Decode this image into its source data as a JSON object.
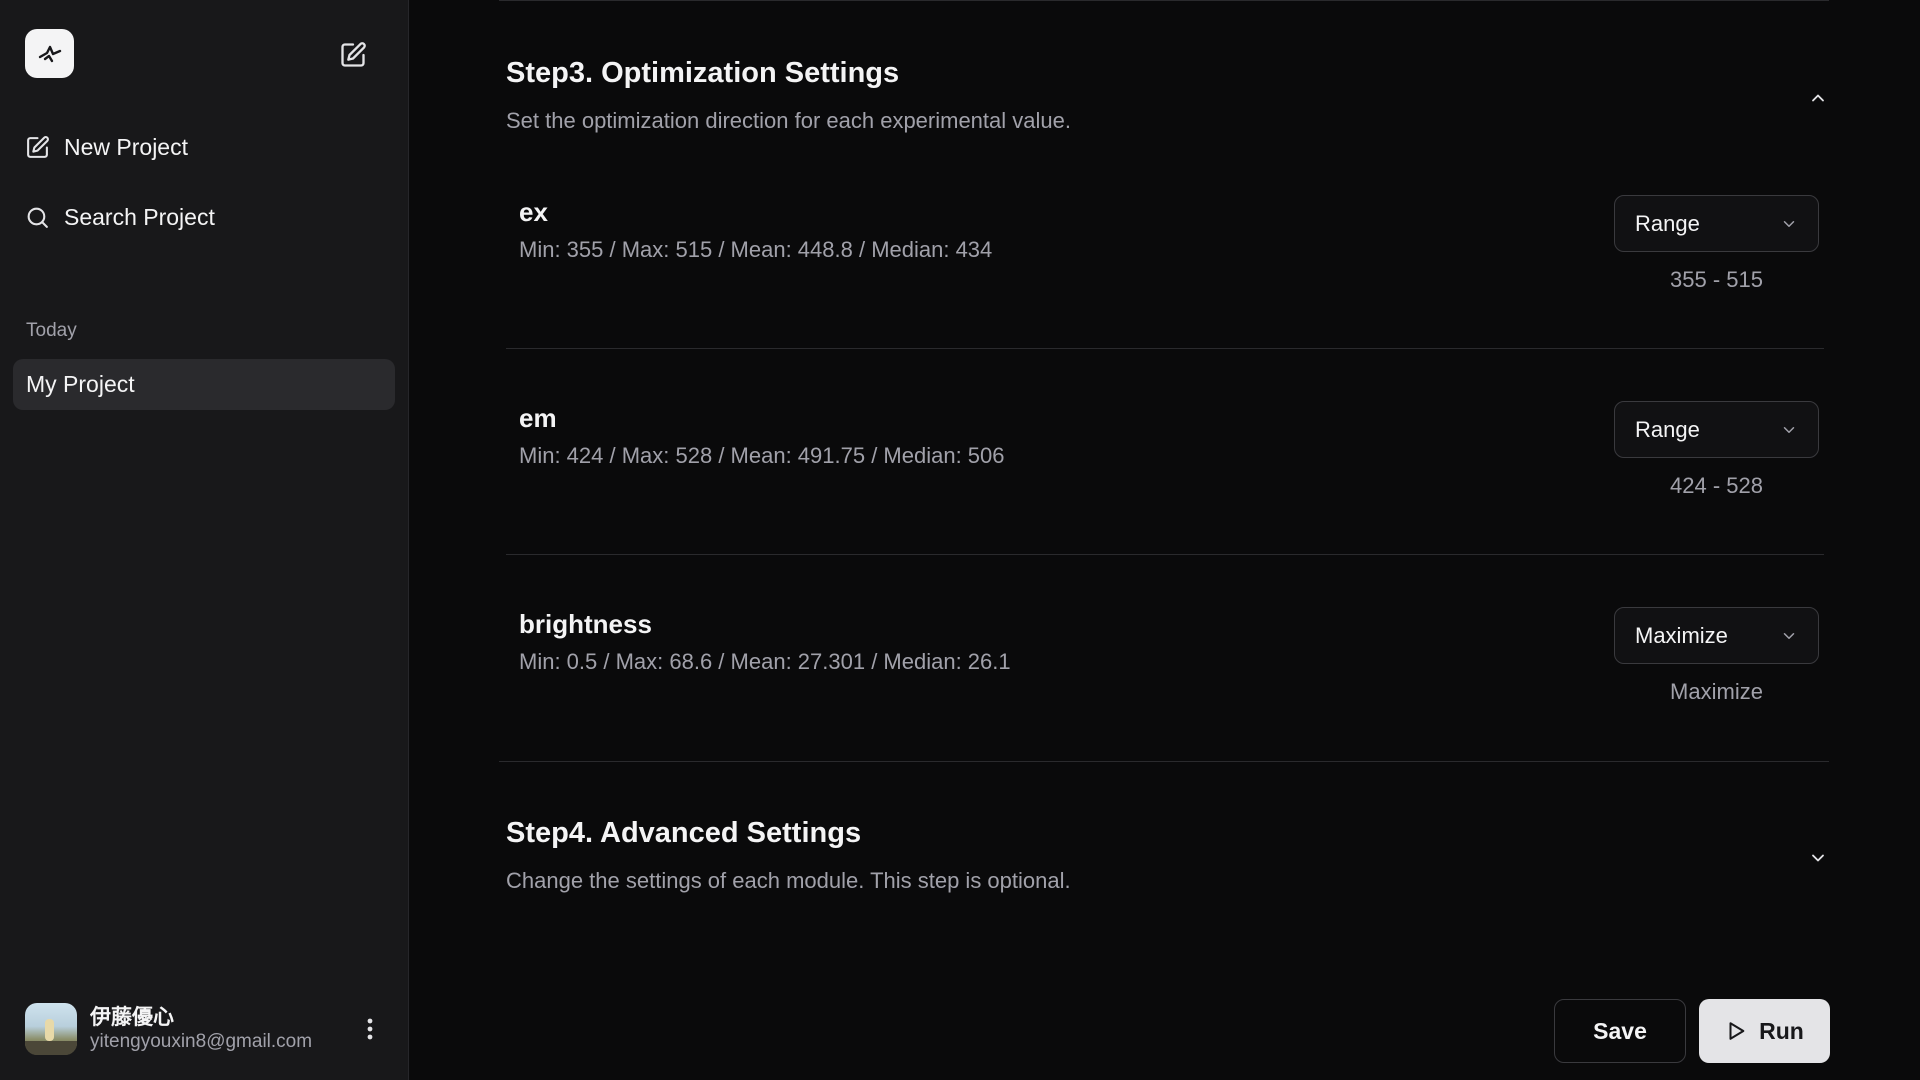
{
  "sidebar": {
    "new_project": "New Project",
    "search_project": "Search Project",
    "section_today": "Today",
    "projects": [
      {
        "label": "My Project",
        "active": true
      }
    ],
    "user": {
      "name": "伊藤優心",
      "email": "yitengyouxin8@gmail.com"
    }
  },
  "main": {
    "step3": {
      "title": "Step3. Optimization Settings",
      "description": "Set the optimization direction for each experimental value.",
      "expanded": true,
      "variables": [
        {
          "name": "ex",
          "stats": "Min: 355 / Max: 515 / Mean: 448.8 / Median: 434",
          "mode": "Range",
          "value_text": "355 - 515"
        },
        {
          "name": "em",
          "stats": "Min: 424 / Max: 528 / Mean: 491.75 / Median: 506",
          "mode": "Range",
          "value_text": "424 - 528"
        },
        {
          "name": "brightness",
          "stats": "Min: 0.5 / Max: 68.6 / Mean: 27.301 / Median: 26.1",
          "mode": "Maximize",
          "value_text": "Maximize"
        }
      ]
    },
    "step4": {
      "title": "Step4. Advanced Settings",
      "description": "Change the settings of each module. This step is optional.",
      "expanded": false
    },
    "actions": {
      "save": "Save",
      "run": "Run"
    }
  },
  "icons": {
    "logo": "logo-icon",
    "compose": "compose-icon",
    "search": "search-icon",
    "chevron_up": "chevron-up-icon",
    "chevron_down": "chevron-down-icon",
    "more": "more-vertical-icon",
    "play": "play-icon"
  },
  "colors": {
    "background": "#0a0a0b",
    "sidebar": "#18181a",
    "active_item": "#2a2a2d",
    "run_button": "#e4e4e7"
  }
}
